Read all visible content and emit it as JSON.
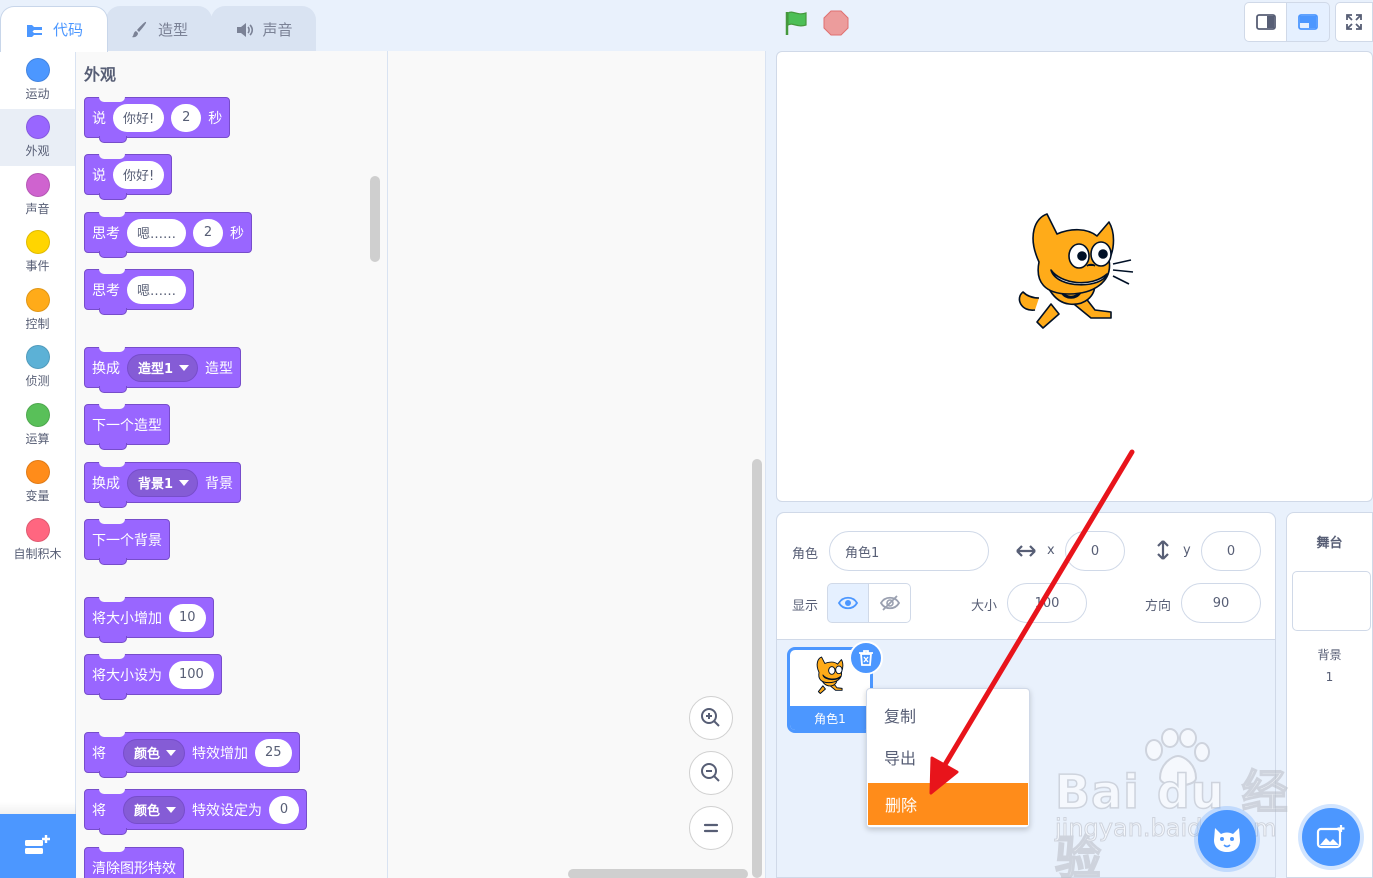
{
  "tabs": [
    {
      "label": "代码",
      "icon": "code-icon",
      "active": true
    },
    {
      "label": "造型",
      "icon": "brush-icon",
      "active": false
    },
    {
      "label": "声音",
      "icon": "speaker-icon",
      "active": false
    }
  ],
  "categories": [
    {
      "label": "运动",
      "color": "#4c97ff"
    },
    {
      "label": "外观",
      "color": "#9966ff"
    },
    {
      "label": "声音",
      "color": "#cf63cf"
    },
    {
      "label": "事件",
      "color": "#ffd500"
    },
    {
      "label": "控制",
      "color": "#ffab19"
    },
    {
      "label": "侦测",
      "color": "#5cb1d6"
    },
    {
      "label": "运算",
      "color": "#59c059"
    },
    {
      "label": "变量",
      "color": "#ff8c1a"
    },
    {
      "label": "自制积木",
      "color": "#ff6680"
    }
  ],
  "palette": {
    "title": "外观",
    "blocks": {
      "say_secs": {
        "word": "说",
        "text": "你好!",
        "num": "2",
        "unit": "秒"
      },
      "say": {
        "word": "说",
        "text": "你好!"
      },
      "think_secs": {
        "word": "思考",
        "text": "嗯……",
        "num": "2",
        "unit": "秒"
      },
      "think": {
        "word": "思考",
        "text": "嗯……"
      },
      "switch_costume": {
        "word": "换成",
        "menu": "造型1",
        "suffix": "造型"
      },
      "next_costume": {
        "label": "下一个造型"
      },
      "switch_backdrop": {
        "word": "换成",
        "menu": "背景1",
        "suffix": "背景"
      },
      "next_backdrop": {
        "label": "下一个背景"
      },
      "change_size": {
        "label": "将大小增加",
        "num": "10"
      },
      "set_size": {
        "label": "将大小设为",
        "num": "100"
      },
      "change_effect": {
        "word": "将",
        "menu": "颜色",
        "label": "特效增加",
        "num": "25"
      },
      "set_effect": {
        "word": "将",
        "menu": "颜色",
        "label": "特效设定为",
        "num": "0"
      },
      "clear_effects": {
        "label": "清除图形特效"
      }
    }
  },
  "sprite_info": {
    "sprite_label": "角色",
    "sprite_name": "角色1",
    "x_label": "x",
    "x_value": "0",
    "y_label": "y",
    "y_value": "0",
    "show_label": "显示",
    "size_label": "大小",
    "size_value": "100",
    "direction_label": "方向",
    "direction_value": "90"
  },
  "sprite_list": [
    {
      "name": "角色1",
      "selected": true
    }
  ],
  "context_menu": [
    {
      "label": "复制",
      "highlighted": false
    },
    {
      "label": "导出",
      "highlighted": false
    },
    {
      "label": "删除",
      "highlighted": true
    }
  ],
  "stage_panel": {
    "title": "舞台",
    "backdrops_label": "背景",
    "backdrops_count": "1"
  },
  "watermark": {
    "brand": "Bai  du 经验",
    "url": "jingyan.baidu.com"
  },
  "colors": {
    "accent": "#4c97ff",
    "looks": "#9966ff",
    "highlight": "#ff8c1a",
    "arrow": "#e8141b"
  }
}
